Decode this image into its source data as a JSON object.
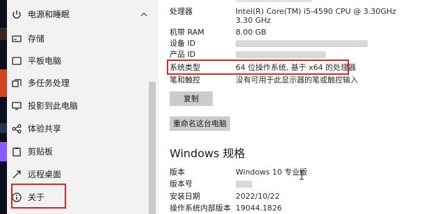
{
  "sidebar": {
    "items": [
      {
        "label": "电源和睡眠",
        "icon": "power-icon"
      },
      {
        "label": "存储",
        "icon": "storage-icon"
      },
      {
        "label": "平板电脑",
        "icon": "tablet-icon"
      },
      {
        "label": "多任务处理",
        "icon": "multitasking-icon"
      },
      {
        "label": "投影到此电脑",
        "icon": "projection-icon"
      },
      {
        "label": "体验共享",
        "icon": "share-icon"
      },
      {
        "label": "剪贴板",
        "icon": "clipboard-icon"
      },
      {
        "label": "远程桌面",
        "icon": "remote-desktop-icon"
      },
      {
        "label": "关于",
        "icon": "info-icon"
      }
    ]
  },
  "device_specs": {
    "processor_label": "处理器",
    "processor_value": "Intel(R) Core(TM) i5-4590 CPU @ 3.30GHz   3.30 GHz",
    "ram_label": "机带 RAM",
    "ram_value": "8.00 GB",
    "device_id_label": "设备 ID",
    "product_id_label": "产品 ID",
    "system_type_label": "系统类型",
    "system_type_value": "64 位操作系统, 基于 x64 的处理器",
    "pen_touch_label": "笔和触控",
    "pen_touch_value": "没有可用于此显示器的笔或触控输入",
    "copy_button": "复制",
    "rename_button": "重命名这台电脑"
  },
  "windows_specs": {
    "title": "Windows 规格",
    "edition_label": "版本",
    "edition_value": "Windows 10 专业版",
    "version_label": "版本号",
    "install_date_label": "安装日期",
    "install_date_value": "2022/10/22",
    "os_build_label": "操作系统内部版本",
    "os_build_value": "19044.1826"
  },
  "colors": {
    "highlight": "#e02424",
    "sidebar_bg": "#f2f2f2",
    "button_bg": "#cccccc"
  }
}
